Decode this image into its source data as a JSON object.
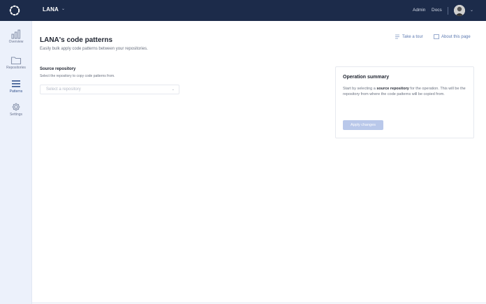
{
  "topbar": {
    "org_name": "LANA",
    "links": [
      "Admin",
      "Docs"
    ],
    "caret": "⌄"
  },
  "sidebar": {
    "items": [
      {
        "label": "Overview",
        "icon": "bar-chart-icon",
        "active": false
      },
      {
        "label": "Repositories",
        "icon": "folder-icon",
        "active": false
      },
      {
        "label": "Patterns",
        "icon": "list-icon",
        "active": true
      },
      {
        "label": "Settings",
        "icon": "gear-icon",
        "active": false
      }
    ]
  },
  "header": {
    "title": "LANA's code patterns",
    "subtitle": "Easily bulk apply code patterns between your repositories.",
    "tour_link": "Take a tour",
    "about_link": "About this page"
  },
  "source": {
    "label": "Source repository",
    "help": "Select the repository to copy code patterns from.",
    "placeholder": "Select a repository"
  },
  "summary": {
    "title": "Operation summary",
    "text_pre": "Start by selecting a ",
    "text_bold": "source repository",
    "text_post": " for the operation. This will be the repository from where the code patterns will be copied from.",
    "apply_label": "Apply changes"
  },
  "colors": {
    "topbar": "#1c2b4a",
    "sidebar": "#ecf1fb",
    "accent_link": "#5b78b0",
    "apply_disabled": "#b9c8ea"
  }
}
